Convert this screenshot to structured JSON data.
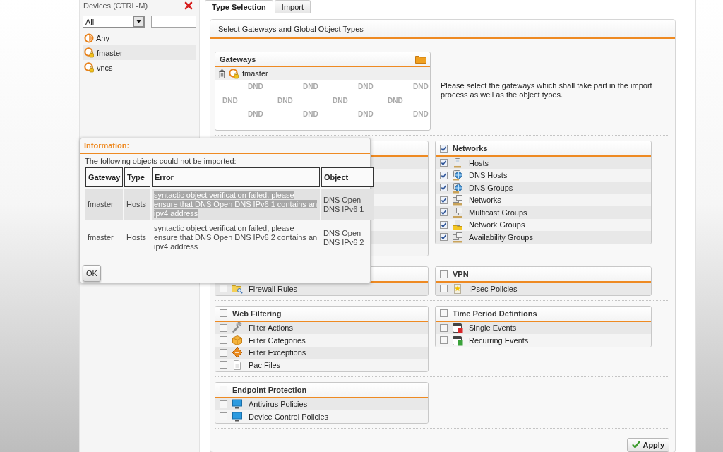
{
  "sidebar": {
    "title": "Devices (CTRL-M)",
    "filter": {
      "value": "All"
    },
    "items": [
      {
        "label": "Any",
        "kind": "any",
        "selected": false
      },
      {
        "label": "fmaster",
        "kind": "gateway",
        "selected": true
      },
      {
        "label": "vncs",
        "kind": "gateway",
        "selected": false
      }
    ]
  },
  "tabs": [
    {
      "label": "Type Selection",
      "selected": true
    },
    {
      "label": "Import",
      "selected": false
    }
  ],
  "panel": {
    "title": "Select Gateways and Global Object Types",
    "gateways": {
      "title": "Gateways",
      "items": [
        {
          "label": "fmaster"
        }
      ],
      "drop_zone": [
        [
          "DND",
          "DND",
          "DND",
          "DND"
        ],
        [
          "DND",
          "DND",
          "DND",
          "DND"
        ],
        [
          "DND",
          "DND",
          "DND",
          "DND"
        ]
      ]
    },
    "hint": "Please select the gateways which shall take part in the import process as well as the object types.",
    "group_rows": [
      [
        {
          "kind": "covered"
        },
        {
          "kind": "group",
          "title": "Networks",
          "checked": true,
          "items": [
            {
              "label": "Hosts",
              "kind": "host",
              "checked": true
            },
            {
              "label": "DNS Hosts",
              "kind": "dns",
              "checked": true
            },
            {
              "label": "DNS Groups",
              "kind": "dns",
              "checked": true
            },
            {
              "label": "Networks",
              "kind": "network",
              "checked": true
            },
            {
              "label": "Multicast Groups",
              "kind": "network",
              "checked": true
            },
            {
              "label": "Network Groups",
              "kind": "netgroup",
              "checked": true
            },
            {
              "label": "Availability Groups",
              "kind": "network",
              "checked": true
            }
          ]
        }
      ],
      [
        {
          "kind": "group",
          "items": [
            {
              "label": "Firewall Rules",
              "kind": "rules",
              "checked": false
            }
          ]
        },
        {
          "kind": "group",
          "title": "VPN",
          "checked": false,
          "items": [
            {
              "label": "IPsec Policies",
              "kind": "vpn",
              "checked": false
            }
          ]
        }
      ],
      [
        {
          "kind": "group",
          "title": "Web Filtering",
          "checked": false,
          "items": [
            {
              "label": "Filter Actions",
              "kind": "wrench",
              "checked": false
            },
            {
              "label": "Filter Categories",
              "kind": "category",
              "checked": false
            },
            {
              "label": "Filter Exceptions",
              "kind": "exception",
              "checked": false
            },
            {
              "label": "Pac Files",
              "kind": "file",
              "checked": false
            }
          ]
        },
        {
          "kind": "group",
          "title": "Time Period Defintions",
          "checked": false,
          "items": [
            {
              "label": "Single Events",
              "kind": "once",
              "checked": false
            },
            {
              "label": "Recurring Events",
              "kind": "recurring",
              "checked": false
            }
          ]
        }
      ],
      [
        {
          "kind": "group",
          "title": "Endpoint Protection",
          "checked": false,
          "items": [
            {
              "label": "Antivirus Policies",
              "kind": "monitor",
              "checked": false
            },
            {
              "label": "Device Control Policies",
              "kind": "monitor",
              "checked": false
            }
          ]
        }
      ]
    ],
    "apply_button": {
      "label": "Apply"
    }
  },
  "dialog": {
    "title": "Information:",
    "message": "The following objects could not be imported:",
    "table": {
      "columns": [
        "Gateway",
        "Type",
        "Error",
        "Object"
      ],
      "rows": [
        {
          "selected": true,
          "cells": [
            "fmaster",
            "Hosts",
            "syntactic object verification failed, please ensure that DNS Open DNS IPv6 1 contains an ipv4 address",
            "DNS Open DNS IPv6 1"
          ]
        },
        {
          "selected": false,
          "cells": [
            "fmaster",
            "Hosts",
            "syntactic object verification failed, please ensure that DNS Open DNS IPv6 2 contains an ipv4 address",
            "DNS Open DNS IPv6 2"
          ]
        }
      ]
    },
    "button": "OK"
  }
}
